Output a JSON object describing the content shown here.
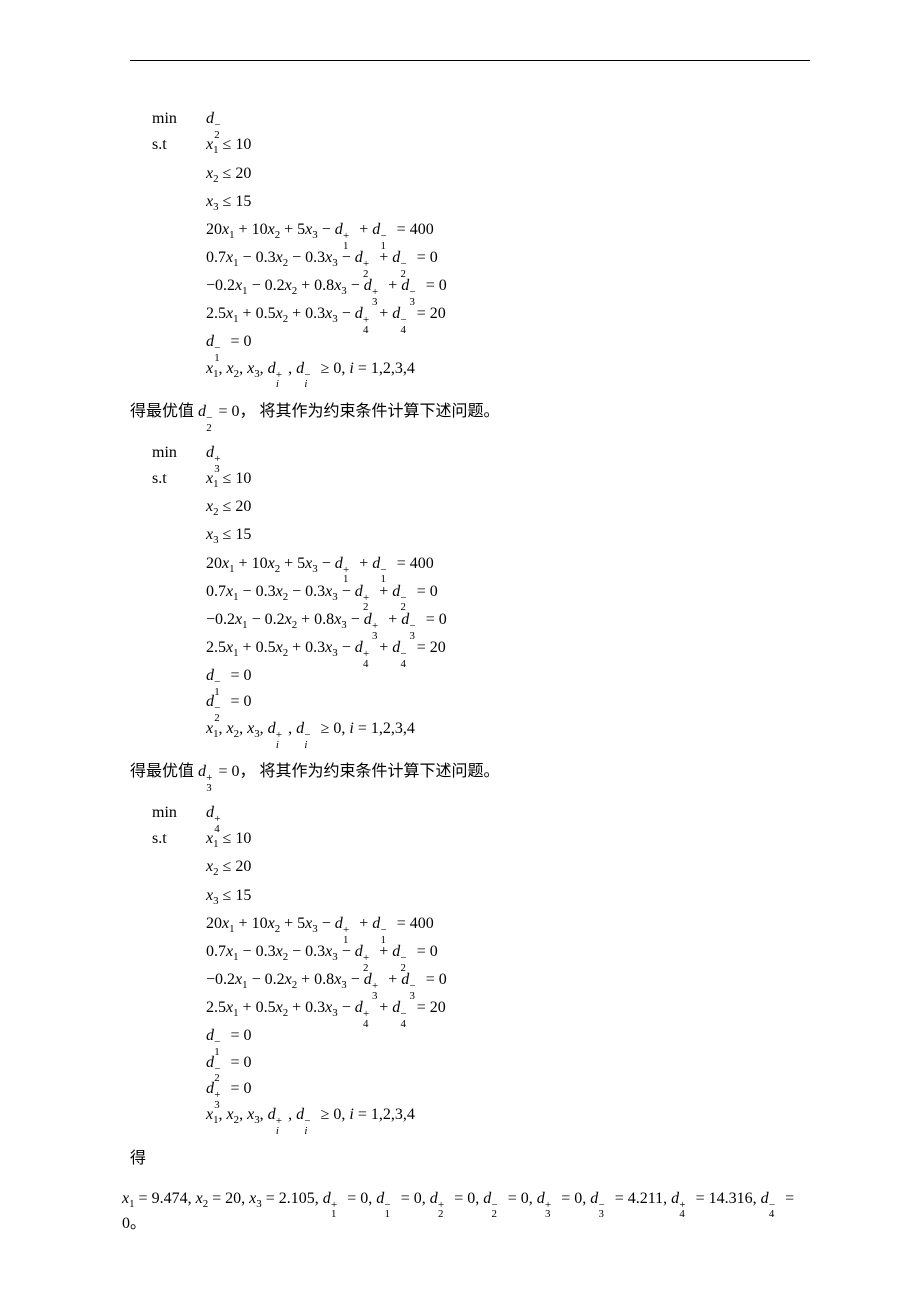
{
  "blocks": [
    {
      "objective": {
        "label": "min",
        "target_var": "d",
        "target_sub": "2",
        "target_sup": "−"
      },
      "st_label": "s.t",
      "constraints": [
        "x₁ ≤ 10",
        "x₂ ≤ 20",
        "x₃ ≤ 15",
        "20x₁ + 10x₂ + 5x₃ − d₁⁺ + d₁⁻ = 400",
        "0.7x₁ − 0.3x₂ − 0.3x₃ − d₂⁺ + d₂⁻ = 0",
        "−0.2x₁ − 0.2x₂ + 0.8x₃ − d₃⁺ + d₃⁻ = 0",
        "2.5x₁ + 0.5x₂ + 0.3x₃ − d₄⁺ + d₄⁻ = 20",
        "d₁⁻ = 0",
        "x₁, x₂, x₃, dᵢ⁺, dᵢ⁻ ≥ 0, i = 1,2,3,4"
      ],
      "followup_prefix": "得最优值",
      "followup_var": "d₂⁻",
      "followup_value": "= 0",
      "followup_suffix": "， 将其作为约束条件计算下述问题。"
    },
    {
      "objective": {
        "label": "min",
        "target_var": "d",
        "target_sub": "3",
        "target_sup": "+"
      },
      "st_label": "s.t",
      "constraints": [
        "x₁ ≤ 10",
        "x₂ ≤ 20",
        "x₃ ≤ 15",
        "20x₁ + 10x₂ + 5x₃ − d₁⁺ + d₁⁻ = 400",
        "0.7x₁ − 0.3x₂ − 0.3x₃ − d₂⁺ + d₂⁻ = 0",
        "−0.2x₁ − 0.2x₂ + 0.8x₃ − d₃⁺ + d₃⁻ = 0",
        "2.5x₁ + 0.5x₂ + 0.3x₃ − d₄⁺ + d₄⁻ = 20",
        "d₁⁻ = 0",
        "d₂⁻ = 0",
        "x₁, x₂, x₃, dᵢ⁺, dᵢ⁻ ≥ 0, i = 1,2,3,4"
      ],
      "followup_prefix": "得最优值",
      "followup_var": "d₃⁺",
      "followup_value": "= 0",
      "followup_suffix": "， 将其作为约束条件计算下述问题。"
    },
    {
      "objective": {
        "label": "min",
        "target_var": "d",
        "target_sub": "4",
        "target_sup": "+"
      },
      "st_label": "s.t",
      "constraints": [
        "x₁ ≤ 10",
        "x₂ ≤ 20",
        "x₃ ≤ 15",
        "20x₁ + 10x₂ + 5x₃ − d₁⁺ + d₁⁻ = 400",
        "0.7x₁ − 0.3x₂ − 0.3x₃ − d₂⁺ + d₂⁻ = 0",
        "−0.2x₁ − 0.2x₂ + 0.8x₃ − d₃⁺ + d₃⁻ = 0",
        "2.5x₁ + 0.5x₂ + 0.3x₃ − d₄⁺ + d₄⁻ = 20",
        "d₁⁻ = 0",
        "d₂⁻ = 0",
        "d₃⁺ = 0",
        "x₁, x₂, x₃, dᵢ⁺, dᵢ⁻ ≥ 0, i = 1,2,3,4"
      ]
    }
  ],
  "final_lead": "得",
  "final_result": "x₁ = 9.474, x₂ = 20, x₃ = 2.105, d₁⁺ = 0, d₁⁻ = 0, d₂⁺ = 0, d₂⁻ = 0, d₃⁺ = 0, d₃⁻ = 4.211, d₄⁺ = 14.316, d₄⁻ = 0。"
}
